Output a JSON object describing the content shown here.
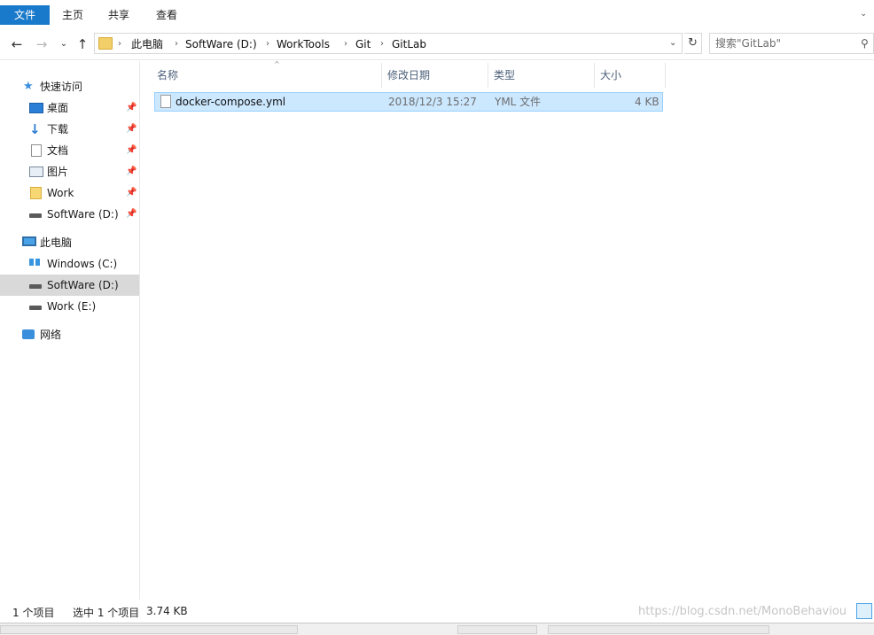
{
  "ribbon": {
    "tabs": [
      "文件",
      "主页",
      "共享",
      "查看"
    ]
  },
  "nav": {
    "breadcrumb": [
      "此电脑",
      "SoftWare (D:)",
      "WorkTools",
      "Git",
      "GitLab"
    ],
    "search_placeholder": "搜索\"GitLab\""
  },
  "sidebar": {
    "quick_access": "快速访问",
    "pinned": [
      {
        "label": "桌面",
        "icon": "desktop-icon"
      },
      {
        "label": "下载",
        "icon": "download-icon"
      },
      {
        "label": "文档",
        "icon": "document-icon"
      },
      {
        "label": "图片",
        "icon": "pictures-icon"
      },
      {
        "label": "Work",
        "icon": "folder-icon"
      },
      {
        "label": "SoftWare (D:)",
        "icon": "drive-icon"
      }
    ],
    "this_pc": "此电脑",
    "drives": [
      {
        "label": "Windows (C:)",
        "icon": "windows-drive-icon"
      },
      {
        "label": "SoftWare (D:)",
        "icon": "drive-icon",
        "selected": true
      },
      {
        "label": "Work (E:)",
        "icon": "drive-icon"
      }
    ],
    "network": "网络"
  },
  "columns": [
    "名称",
    "修改日期",
    "类型",
    "大小"
  ],
  "files": [
    {
      "name": "docker-compose.yml",
      "modified": "2018/12/3 15:27",
      "type": "YML 文件",
      "size": "4 KB",
      "selected": true
    }
  ],
  "status": {
    "item_count": "1 个项目",
    "selection": "选中 1 个项目",
    "selection_size": "3.74 KB"
  },
  "watermark": "https://blog.csdn.net/MonoBehaviou",
  "colors": {
    "file_tab": "#1979ca",
    "selection_bg": "#cce8ff",
    "selection_border": "#99d1ff",
    "nav_selected": "#d9d9d9"
  }
}
